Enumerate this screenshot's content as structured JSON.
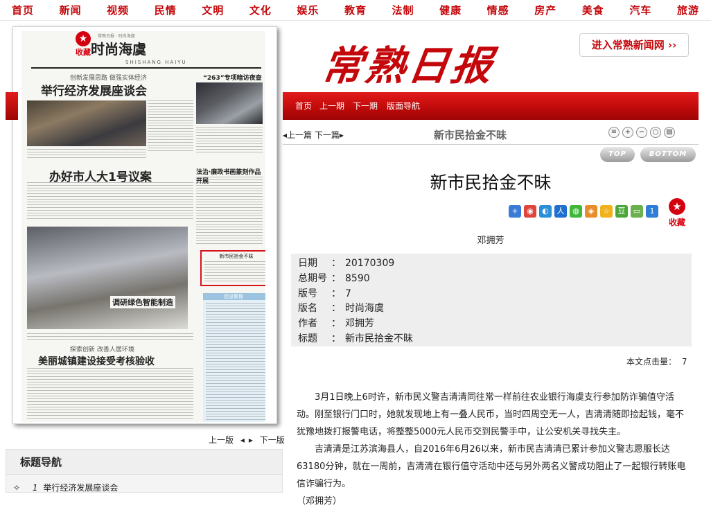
{
  "top_nav": [
    "首页",
    "新闻",
    "视频",
    "民情",
    "文明",
    "文化",
    "娱乐",
    "教育",
    "法制",
    "健康",
    "情感",
    "房产",
    "美食",
    "汽车",
    "旅游"
  ],
  "paper_page": {
    "collect_label": "收藏",
    "page_title": "时尚海虞",
    "page_title_pinyin": "SHISHANG HAIYU",
    "headline_1_kicker": "创新发展思路 做强实体经济",
    "headline_1": "举行经济发展座谈会",
    "headline_2": "办好市人大1号议案",
    "headline_3_kicker": "“263”专项暗访夜查",
    "headline_4_kicker": "法治·廉政书画篆刻作品开展",
    "headline_5": "调研绿色智能制造",
    "headline_6_kicker": "探索创新 改善人居环境",
    "headline_6": "美丽城镇建设接受考核验收",
    "highlight_title": "新市民拾金不昧",
    "info_box_title": "信息集锦"
  },
  "left_pager": {
    "prev": "上一版",
    "next": "下一版"
  },
  "title_nav": {
    "heading": "标题导航",
    "items": [
      {
        "index": "1",
        "title": "举行经济发展座谈会"
      }
    ]
  },
  "header": {
    "logo_text": "常熟日报",
    "enter_button": "进入常熟新闻网 ›› "
  },
  "red_bar": {
    "links": [
      "首页",
      "上一期",
      "下一期",
      "版面导航"
    ]
  },
  "article_toolbar": {
    "prev_next": "◂上一篇 下一篇▸",
    "title": "新市民拾金不昧",
    "top_label": "TOP",
    "bottom_label": "BOTTOM"
  },
  "article": {
    "title": "新市民拾金不昧",
    "author": "邓拥芳",
    "collect_label": "收藏",
    "meta": [
      {
        "k": "日期",
        "v": "20170309"
      },
      {
        "k": "总期号",
        "v": "8590"
      },
      {
        "k": "版号",
        "v": "7"
      },
      {
        "k": "版名",
        "v": "时尚海虞"
      },
      {
        "k": "作者",
        "v": "邓拥芳"
      },
      {
        "k": "标题",
        "v": "新市民拾金不昧"
      }
    ],
    "click_label": "本文点击量：",
    "click_count": "7",
    "paragraphs": [
      "3月1日晚上6时许，新市民义警吉清清同往常一样前往农业银行海虞支行参加防诈骗值守活动。刚至银行门口时，她就发现地上有一叠人民币，当时四周空无一人，吉清清随即捡起钱，毫不犹豫地拨打报警电话，将整整5000元人民币交到民警手中，让公安机关寻找失主。",
      "吉清清是江苏滨海县人，自2016年6月26以来，新市民吉清清已累计参加义警志愿服长达63180分钟，就在一周前，吉清清在银行值守活动中还与另外两名义警成功阻止了一起银行转账电信诈骗行为。"
    ],
    "sign_off": "（邓拥芳）"
  },
  "colors": {
    "brand_red": "#c4070b",
    "bar_red": "#d41414",
    "meta_bg": "#eeeeee"
  }
}
